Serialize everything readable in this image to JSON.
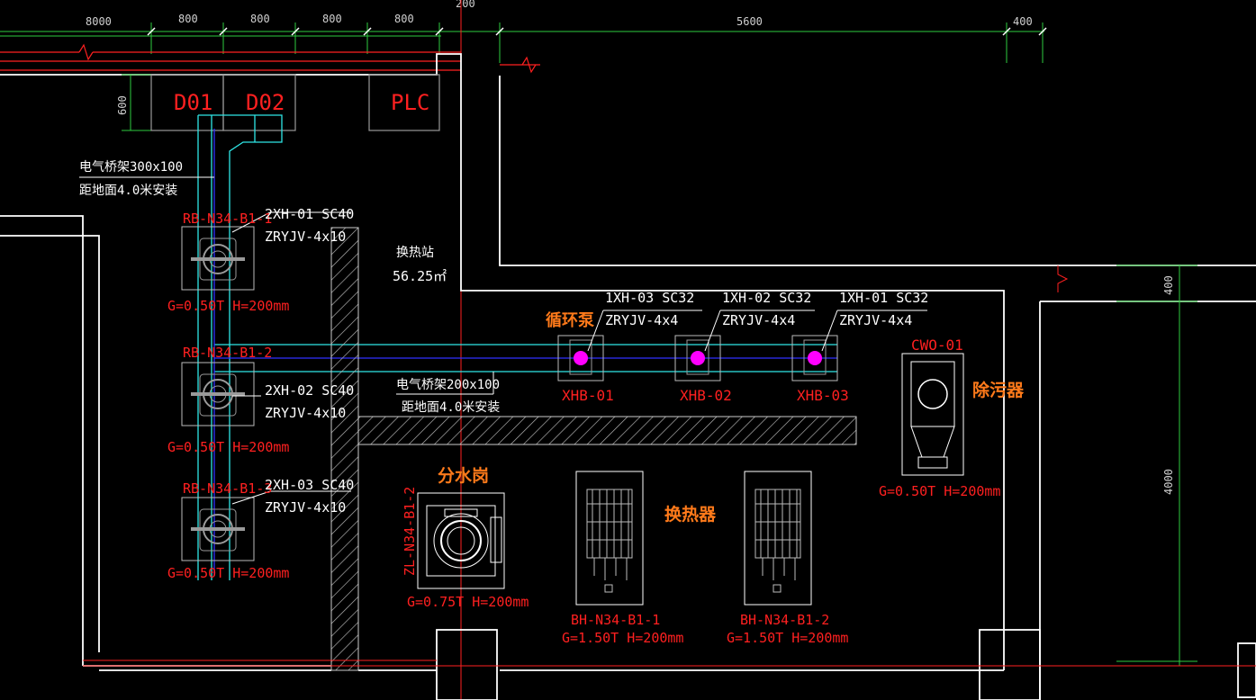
{
  "dims": {
    "top": [
      "8000",
      "800",
      "800",
      "800",
      "800",
      "200",
      "5600",
      "400"
    ],
    "left_600": "600",
    "right_400": "400",
    "right_4000": "4000"
  },
  "cabinets": [
    "D01",
    "D02",
    "PLC"
  ],
  "tray1": {
    "line1": "电气桥架300x100",
    "line2": "距地面4.0米安装"
  },
  "tray2": {
    "line1": "电气桥架200x100",
    "line2": "距地面4.0米安装"
  },
  "room": {
    "name": "换热站",
    "area": "56.25㎡"
  },
  "rb_units": [
    {
      "tag": "RB-N34-B1-1",
      "cable1": "2XH-01 SC40",
      "cable2": "ZRYJV-4x10",
      "weight": "G=0.50T  H=200mm"
    },
    {
      "tag": "RB-N34-B1-2",
      "cable1": "2XH-02 SC40",
      "cable2": "ZRYJV-4x10",
      "weight": "G=0.50T  H=200mm"
    },
    {
      "tag": "RB-N34-B1-3",
      "cable1": "2XH-03 SC40",
      "cable2": "ZRYJV-4x10",
      "weight": "G=0.50T  H=200mm"
    }
  ],
  "pumps_title": "循环泵",
  "pumps": [
    {
      "tag": "XHB-01",
      "cable1": "1XH-03 SC32",
      "cable2": "ZRYJV-4x4"
    },
    {
      "tag": "XHB-02",
      "cable1": "1XH-02 SC32",
      "cable2": "ZRYJV-4x4"
    },
    {
      "tag": "XHB-03",
      "cable1": "1XH-01 SC32",
      "cable2": "ZRYJV-4x4"
    }
  ],
  "strainer": {
    "tag": "CWO-01",
    "name": "除污器",
    "weight": "G=0.50T  H=200mm"
  },
  "distributor": {
    "title": "分水岗",
    "tag": "ZL-N34-B1-2",
    "weight": "G=0.75T  H=200mm"
  },
  "exchanger_title": "换热器",
  "exchangers": [
    {
      "tag": "BH-N34-B1-1",
      "weight": "G=1.50T  H=200mm"
    },
    {
      "tag": "BH-N34-B1-2",
      "weight": "G=1.50T  H=200mm"
    }
  ],
  "colors": {
    "wall": "#ffffff",
    "red_text": "#ff2020",
    "orange_label": "#ff7a1a",
    "cyan_tray": "#2fe6e6",
    "blue_cable": "#3030ff",
    "magenta": "#ff00ff",
    "green_dim": "#2ecc40",
    "gray": "#9a9a9a"
  }
}
